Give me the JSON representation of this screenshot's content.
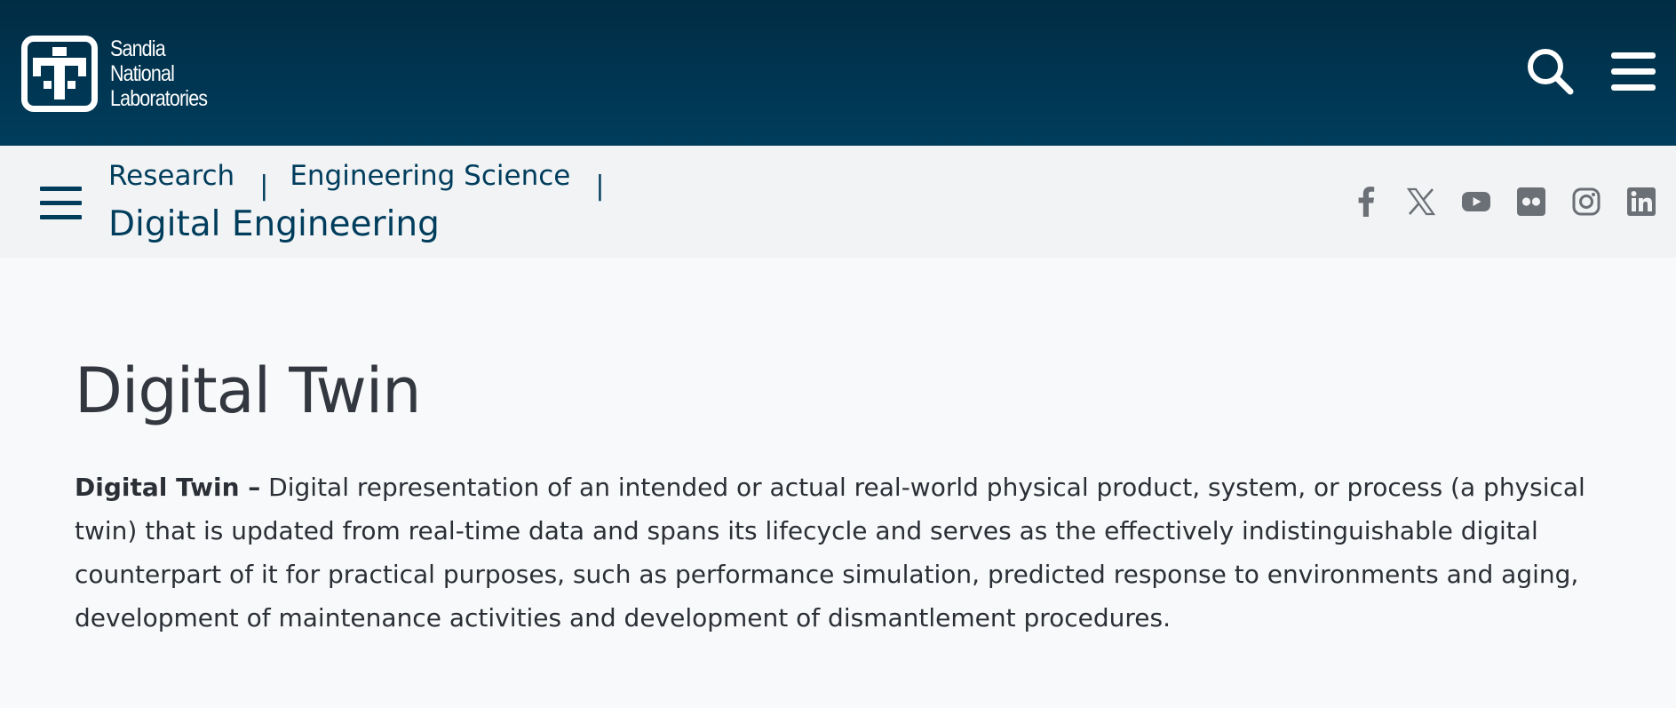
{
  "header": {
    "logo_lines": [
      "Sandia",
      "National",
      "Laboratories"
    ],
    "actions": [
      {
        "name": "search",
        "icon": "search-icon"
      },
      {
        "name": "menu",
        "icon": "hamburger-menu-icon"
      }
    ],
    "background": "#003d5c"
  },
  "subnav": {
    "menu_icon": "hamburger-menu-icon",
    "breadcrumbs": [
      "Research",
      "Engineering Science"
    ],
    "section_title": "Digital Engineering",
    "social_links": [
      {
        "name": "facebook",
        "icon": "facebook-icon"
      },
      {
        "name": "x",
        "icon": "x-twitter-icon"
      },
      {
        "name": "youtube",
        "icon": "youtube-icon"
      },
      {
        "name": "flickr",
        "icon": "flickr-icon"
      },
      {
        "name": "instagram",
        "icon": "instagram-icon"
      },
      {
        "name": "linkedin",
        "icon": "linkedin-icon"
      }
    ],
    "background": "#f2f3f5"
  },
  "main": {
    "title": "Digital Twin",
    "definition_term": "Digital Twin –",
    "definition_text": " Digital representation of an intended or actual real-world physical product, system, or process (a physical twin) that is updated from real-time data and spans its lifecycle and serves as the effectively indistinguishable digital counterpart of it for practical purposes, such as performance simulation, predicted response to environments and aging, development of maintenance activities and development of dismantlement procedures."
  },
  "colors": {
    "brand_navy": "#003d5c",
    "text_dark": "#333840",
    "icon_gray": "#6b6f76"
  }
}
